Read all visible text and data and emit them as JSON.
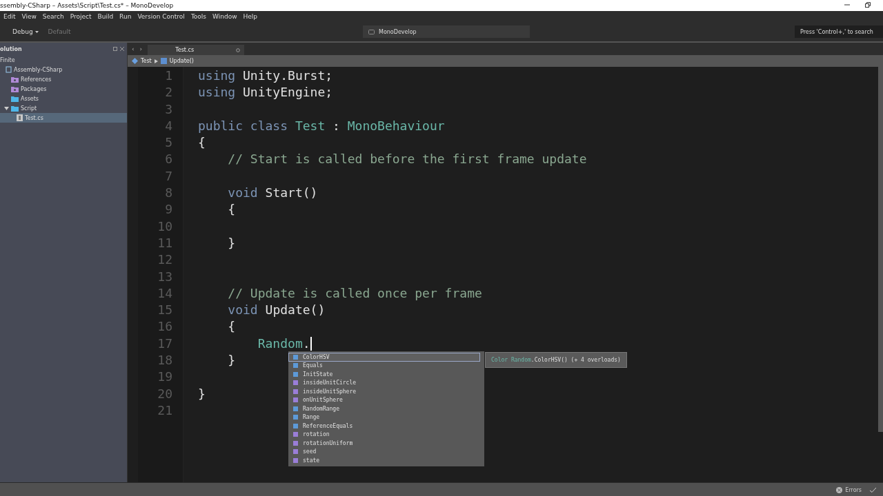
{
  "window": {
    "title": "ssembly-CSharp – Assets\\Script\\Test.cs* – MonoDevelop"
  },
  "menu": [
    "Edit",
    "View",
    "Search",
    "Project",
    "Build",
    "Run",
    "Version Control",
    "Tools",
    "Window",
    "Help"
  ],
  "toolbar": {
    "configuration": "Debug",
    "target": {
      "label": "Default",
      "disabled": true
    },
    "status": "MonoDevelop",
    "search": {
      "placeholder": "Press 'Control+,' to search"
    }
  },
  "solution": {
    "title": "olution",
    "items": [
      {
        "label": "Finite",
        "selected": false,
        "children": [
          {
            "label": "Assembly-CSharp",
            "kind": "project",
            "selected": false,
            "children": [
              {
                "label": "References",
                "kind": "special",
                "selected": false
              },
              {
                "label": "Packages",
                "kind": "special",
                "selected": false
              },
              {
                "label": "Assets",
                "kind": "folder",
                "selected": false
              },
              {
                "label": "Script",
                "kind": "folder",
                "selected": false,
                "expanded": true,
                "children": [
                  {
                    "label": "Test.cs",
                    "kind": "file",
                    "selected": true
                  }
                ]
              }
            ]
          }
        ]
      }
    ]
  },
  "nav": [
    "‹",
    "›"
  ],
  "tabs": [
    {
      "label": "Test.cs",
      "selected": true
    }
  ],
  "breadcrumb": [
    {
      "label": "Test",
      "kind": "class"
    },
    {
      "label": "Update()",
      "kind": "method"
    }
  ],
  "code": [
    {
      "number": "1",
      "tokens": [
        {
          "kind": "keyword",
          "text": "using"
        },
        {
          "kind": "plain",
          "text": " Unity.Burst;"
        }
      ]
    },
    {
      "number": "2",
      "tokens": [
        {
          "kind": "keyword",
          "text": "using"
        },
        {
          "kind": "plain",
          "text": " UnityEngine;"
        }
      ]
    },
    {
      "number": "3"
    },
    {
      "number": "4",
      "tokens": [
        {
          "kind": "keyword",
          "text": "public class"
        },
        {
          "kind": "type",
          "text": " Test"
        },
        {
          "kind": "plain",
          "text": " : "
        },
        {
          "kind": "type",
          "text": "MonoBehaviour"
        }
      ]
    },
    {
      "number": "5",
      "tokens": [
        {
          "kind": "plain",
          "text": "{"
        }
      ]
    },
    {
      "number": "6",
      "tokens": [
        {
          "kind": "comment",
          "text": "    // Start is called before the first frame update"
        }
      ]
    },
    {
      "number": "7"
    },
    {
      "number": "8",
      "tokens": [
        {
          "kind": "keyword",
          "text": "    void"
        },
        {
          "kind": "plain",
          "text": " Start()"
        }
      ]
    },
    {
      "number": "9",
      "tokens": [
        {
          "kind": "plain",
          "text": "    {"
        }
      ]
    },
    {
      "number": "10"
    },
    {
      "number": "11",
      "tokens": [
        {
          "kind": "plain",
          "text": "    }"
        }
      ]
    },
    {
      "number": "12"
    },
    {
      "number": "13"
    },
    {
      "number": "14",
      "tokens": [
        {
          "kind": "comment",
          "text": "    // Update is called once per frame"
        }
      ]
    },
    {
      "number": "15",
      "tokens": [
        {
          "kind": "keyword",
          "text": "    void"
        },
        {
          "kind": "plain",
          "text": " Update()"
        }
      ]
    },
    {
      "number": "16",
      "tokens": [
        {
          "kind": "plain",
          "text": "    {"
        }
      ]
    },
    {
      "number": "17",
      "tokens": [
        {
          "kind": "type",
          "text": "        Random"
        },
        {
          "kind": "plain",
          "text": "."
        }
      ],
      "cursor": true
    },
    {
      "number": "18",
      "tokens": [
        {
          "kind": "plain",
          "text": "    }"
        }
      ]
    },
    {
      "number": "19"
    },
    {
      "number": "20",
      "tokens": [
        {
          "kind": "plain",
          "text": "}"
        }
      ]
    },
    {
      "number": "21"
    }
  ],
  "completion": [
    {
      "label": "ColorHSV",
      "kind": "method",
      "selected": true
    },
    {
      "label": "Equals",
      "kind": "method",
      "selected": false
    },
    {
      "label": "InitState",
      "kind": "method",
      "selected": false
    },
    {
      "label": "insideUnitCircle",
      "kind": "property",
      "selected": false
    },
    {
      "label": "insideUnitSphere",
      "kind": "property",
      "selected": false
    },
    {
      "label": "onUnitSphere",
      "kind": "property",
      "selected": false
    },
    {
      "label": "RandomRange",
      "kind": "method",
      "selected": false
    },
    {
      "label": "Range",
      "kind": "method",
      "selected": false
    },
    {
      "label": "ReferenceEquals",
      "kind": "method",
      "selected": false
    },
    {
      "label": "rotation",
      "kind": "property",
      "selected": false
    },
    {
      "label": "rotationUniform",
      "kind": "property",
      "selected": false
    },
    {
      "label": "seed",
      "kind": "property",
      "selected": false
    },
    {
      "label": "state",
      "kind": "property",
      "selected": false
    }
  ],
  "tooltip": [
    {
      "kind": "type",
      "text": "Color"
    },
    {
      "kind": "type",
      "text": " Random"
    },
    {
      "kind": "plain",
      "text": ".ColorHSV() (+ 4 overloads)"
    }
  ],
  "status_bar": {
    "errors": "Errors"
  }
}
